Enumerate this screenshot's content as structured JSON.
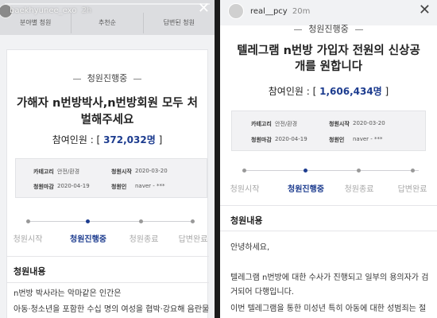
{
  "left": {
    "story": {
      "username": "baekhyunee_exo",
      "time": "2h",
      "close": "✕"
    },
    "tabs": [
      "분야별 청원",
      "추천순",
      "답변된 청원"
    ],
    "status": "청원진행중",
    "title_line1": "가해자 n번방박사,n번방회원 모두 처",
    "title_line2": "벌해주세요",
    "count_label": "참여인원 : [",
    "count_value": "372,032명",
    "count_end": "]",
    "info": {
      "category_label": "카테고리",
      "category": "안전/환경",
      "start_label": "청원시작",
      "start": "2020-03-20",
      "end_label": "청원마감",
      "end": "2020-04-19",
      "author_label": "청원인",
      "author": "naver - ***"
    },
    "steps": [
      "청원시작",
      "청원진행중",
      "청원종료",
      "답변완료"
    ],
    "section_title": "청원내용",
    "body_line1": "n번방 박사라는 악마같은 인간은",
    "body_line2": "아동·청소년을 포함한 수십 명의 여성을 협박·강요해 음란물"
  },
  "right": {
    "story": {
      "username": "real__pcy",
      "time": "20m",
      "close": "✕"
    },
    "status": "청원진행중",
    "title_line1": "텔레그램 n번방 가입자 전원의 신상공",
    "title_line2": "개를 원합니다",
    "count_label": "참여인원 : [",
    "count_value": "1,606,434명",
    "count_end": "]",
    "info": {
      "category_label": "카테고리",
      "category": "안전/환경",
      "start_label": "청원시작",
      "start": "2020-03-20",
      "end_label": "청원마감",
      "end": "2020-04-19",
      "author_label": "청원인",
      "author": "naver - ***"
    },
    "steps": [
      "청원시작",
      "청원진행중",
      "청원종료",
      "답변완료"
    ],
    "section_title": "청원내용",
    "greeting": "안녕하세요,",
    "body_line1": "텔레그램 n번방에 대한 수사가 진행되고 일부의 용의자가 검",
    "body_line2": "거되어 다행입니다.",
    "body_line3": "이번 텔레그램을 통한 미성년 특히 아동에 대한 성범죄는 절"
  }
}
